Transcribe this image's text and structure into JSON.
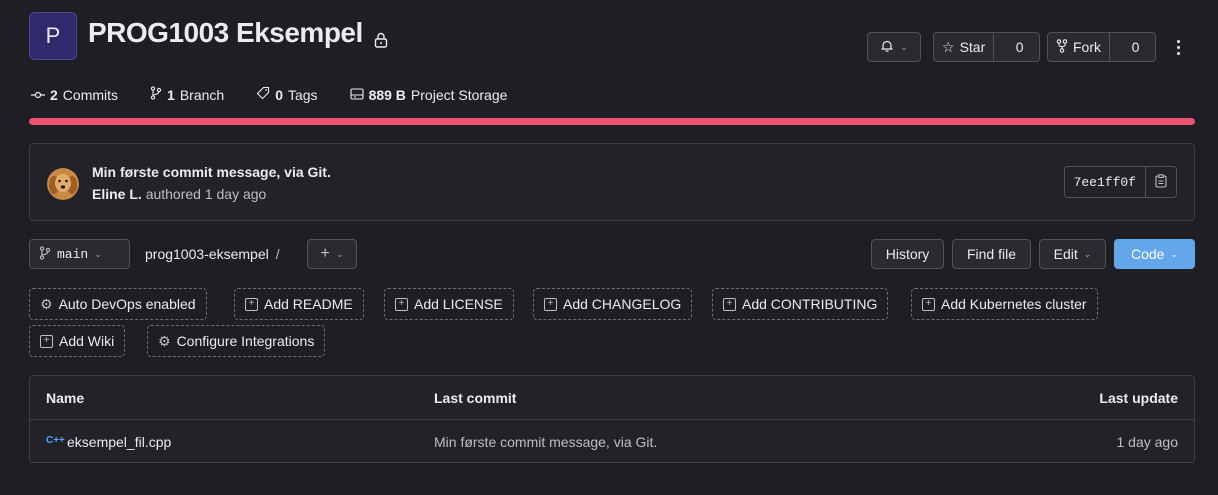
{
  "project": {
    "avatar_letter": "P",
    "title": "PROG1003 Eksempel",
    "lock_icon": "lock-icon"
  },
  "actions": {
    "notification_icon": "bell-icon",
    "star_label": "Star",
    "star_count": "0",
    "fork_label": "Fork",
    "fork_count": "0"
  },
  "stats": {
    "commits_count": "2",
    "commits_label": "Commits",
    "branch_count": "1",
    "branch_label": "Branch",
    "tags_count": "0",
    "tags_label": "Tags",
    "storage_size": "889 B",
    "storage_label": "Project Storage"
  },
  "progress": {
    "color": "#ec5172",
    "fraction": 1.0
  },
  "last_commit": {
    "message": "Min første commit message, via Git.",
    "author": "Eline L.",
    "meta": "authored 1 day ago",
    "sha": "7ee1ff0f"
  },
  "repo_nav": {
    "branch": "main",
    "path": "prog1003-eksempel",
    "separator": "/",
    "add_label": "+",
    "history_label": "History",
    "find_file_label": "Find file",
    "edit_label": "Edit",
    "code_label": "Code",
    "code_color": "#63a6e9"
  },
  "shortcuts": [
    "Auto DevOps enabled",
    "Add README",
    "Add LICENSE",
    "Add CHANGELOG",
    "Add CONTRIBUTING",
    "Add Kubernetes cluster",
    "Add Wiki",
    "Configure Integrations"
  ],
  "file_table": {
    "headers": [
      "Name",
      "Last commit",
      "Last update"
    ],
    "rows": [
      {
        "icon": "C++",
        "name": "eksempel_fil.cpp",
        "commit": "Min første commit message, via Git.",
        "updated": "1 day ago"
      }
    ]
  }
}
